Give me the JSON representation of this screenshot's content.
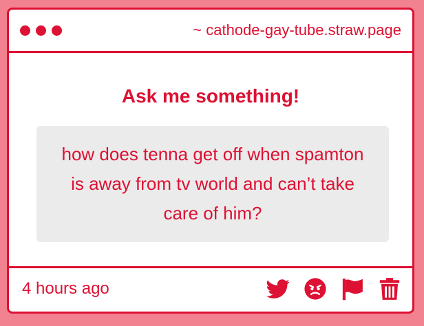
{
  "window": {
    "url": "~ cathode-gay-tube.straw.page"
  },
  "main": {
    "title": "Ask me something!",
    "question": "how does tenna get off when spamton is away from tv world and can’t take care of him?"
  },
  "footer": {
    "timestamp": "4 hours ago",
    "actions": [
      "twitter-icon",
      "angry-face-icon",
      "flag-icon",
      "trash-icon"
    ]
  },
  "colors": {
    "accent": "#dd1133",
    "background": "#f2828f",
    "question_bg": "#ebebeb"
  }
}
